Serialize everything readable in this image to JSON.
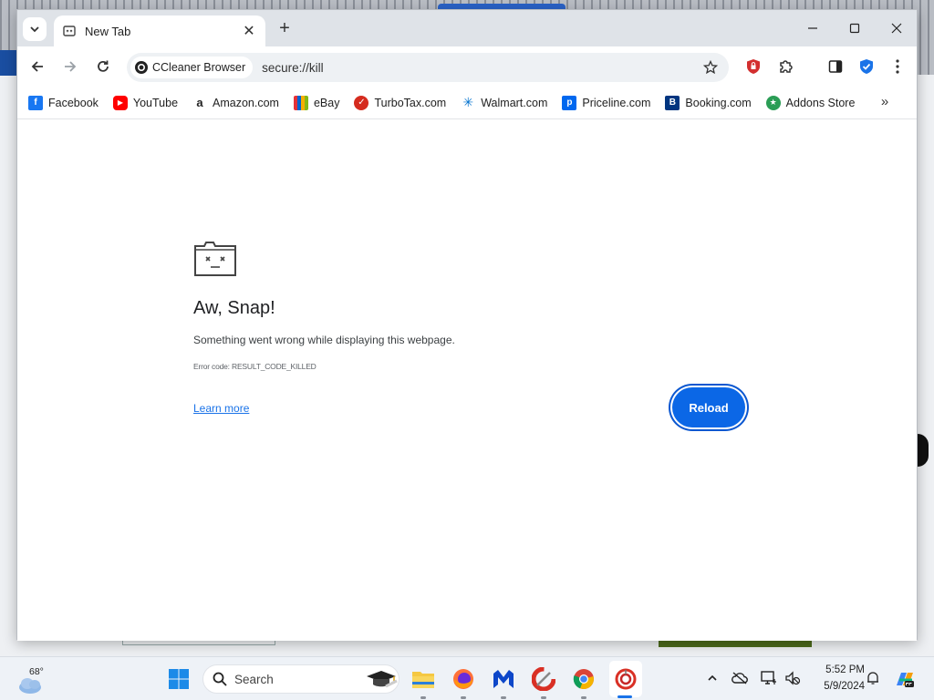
{
  "browser": {
    "tab": {
      "title": "New Tab"
    },
    "omnibox": {
      "site_chip": "CCleaner Browser",
      "url": "secure://kill"
    },
    "bookmarks": [
      {
        "label": "Facebook",
        "icon": "facebook-icon",
        "color": "#1877f2"
      },
      {
        "label": "YouTube",
        "icon": "youtube-icon",
        "color": "#ff0000"
      },
      {
        "label": "Amazon.com",
        "icon": "amazon-icon",
        "color": "#222222"
      },
      {
        "label": "eBay",
        "icon": "ebay-bag-icon",
        "color": "#e53238"
      },
      {
        "label": "TurboTax.com",
        "icon": "turbotax-icon",
        "color": "#d52b1e"
      },
      {
        "label": "Walmart.com",
        "icon": "walmart-spark-icon",
        "color": "#0071ce"
      },
      {
        "label": "Priceline.com",
        "icon": "priceline-icon",
        "color": "#0068ef"
      },
      {
        "label": "Booking.com",
        "icon": "booking-icon",
        "color": "#003580"
      },
      {
        "label": "Addons Store",
        "icon": "addons-store-icon",
        "color": "#2a9d55"
      }
    ]
  },
  "error_page": {
    "title": "Aw, Snap!",
    "message": "Something went wrong while displaying this webpage.",
    "error_code": "Error code: RESULT_CODE_KILLED",
    "learn_more": "Learn more",
    "reload": "Reload",
    "accent_color": "#0b67e6"
  },
  "taskbar": {
    "weather_temp": "68°",
    "search_placeholder": "Search",
    "clock_time": "5:52 PM",
    "clock_date": "5/9/2024"
  }
}
